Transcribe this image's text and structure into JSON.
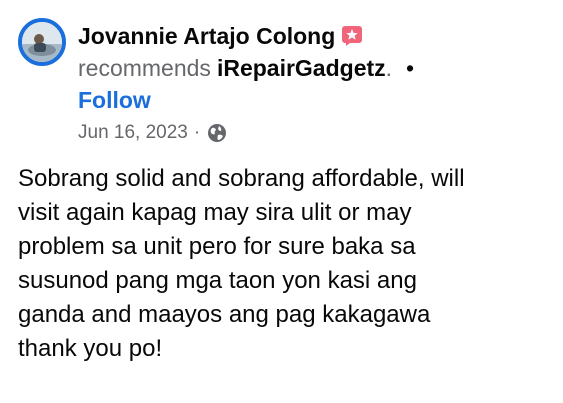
{
  "post": {
    "author_name": "Jovannie Artajo Colong",
    "recommends_text": "recommends",
    "page_name": "iRepairGadgetz",
    "period": ".",
    "separator_dot": "•",
    "follow_label": "Follow",
    "date": "Jun 16, 2023",
    "meta_dot": "·",
    "review_text": "Sobrang solid and sobrang affordable, will\nvisit again kapag may sira ulit or may\nproblem sa unit pero for sure baka sa\nsusunod pang mga taon yon kasi ang\nganda and maayos ang pag kakagawa\nthank you po!"
  },
  "icons": {
    "badge": "star-badge-icon",
    "audience": "globe-icon"
  },
  "colors": {
    "accent": "#1a6fdc",
    "secondary_text": "#65676b",
    "primary_text": "#080809",
    "badge": "#f0657a"
  }
}
